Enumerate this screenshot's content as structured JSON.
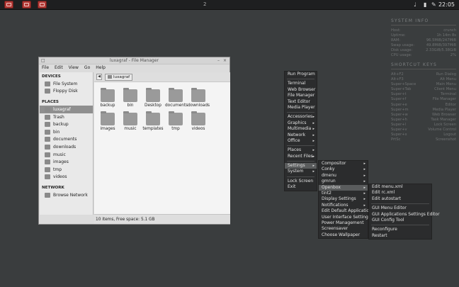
{
  "panel": {
    "workspace": "2",
    "clock": "22:05"
  },
  "conky_system": {
    "title": "SYSTEM INFO",
    "rows": [
      {
        "label": "Host:",
        "value": "crunch"
      },
      {
        "label": "Uptime:",
        "value": "1h 14m 8s"
      },
      {
        "label": "RAM:",
        "value": "96.5MiB/247MiB"
      },
      {
        "label": "Swap usage:",
        "value": "49.8MiB/397MiB"
      },
      {
        "label": "Disk usage:",
        "value": "2.33GiB/5.38GiB"
      },
      {
        "label": "CPU usage:",
        "value": "2%"
      }
    ]
  },
  "conky_keys": {
    "title": "SHORTCUT KEYS",
    "rows": [
      {
        "label": "Alt+F2",
        "value": "Run Dialog"
      },
      {
        "label": "Alt+F3",
        "value": "Alt Menu"
      },
      {
        "label": "Super+Space",
        "value": "Main Menu"
      },
      {
        "label": "Super+Tab",
        "value": "Client Menu"
      },
      {
        "label": "Super+t",
        "value": "Terminal"
      },
      {
        "label": "Super+f",
        "value": "File Manager"
      },
      {
        "label": "Super+e",
        "value": "Editor"
      },
      {
        "label": "Super+m",
        "value": "Media Player"
      },
      {
        "label": "Super+w",
        "value": "Web Browser"
      },
      {
        "label": "Super+h",
        "value": "Task Manager"
      },
      {
        "label": "Super+l",
        "value": "Lock Screen"
      },
      {
        "label": "Super+v",
        "value": "Volume Control"
      },
      {
        "label": "Super+x",
        "value": "Logout"
      },
      {
        "label": "PrtSc",
        "value": "Screenshot"
      }
    ]
  },
  "file_manager": {
    "title": "luxagraf - File Manager",
    "menu": [
      "File",
      "Edit",
      "View",
      "Go",
      "Help"
    ],
    "devices_heading": "DEVICES",
    "devices": [
      "File System",
      "Floppy Disk"
    ],
    "places_heading": "PLACES",
    "places": [
      "luxagraf",
      "Trash",
      "backup",
      "bin",
      "documents",
      "downloads",
      "music",
      "images",
      "tmp",
      "videos"
    ],
    "network_heading": "NETWORK",
    "network": [
      "Browse Network"
    ],
    "location": "luxagraf",
    "folders": [
      "backup",
      "bin",
      "Desktop",
      "documents",
      "downloads",
      "images",
      "music",
      "templates",
      "tmp",
      "videos"
    ],
    "status": "10 items, Free space: 5.1 GB"
  },
  "main_menu": {
    "items": [
      "Run Program",
      "Terminal",
      "Web Browser",
      "File Manager",
      "Text Editor",
      "Media Player",
      "Accessories",
      "Graphics",
      "Multimedia",
      "Network",
      "Office",
      "Places",
      "Recent Files",
      "Settings",
      "System",
      "Lock Screen",
      "Exit"
    ]
  },
  "settings_menu": {
    "items": [
      "Compositor",
      "Conky",
      "dmenu",
      "gmrun",
      "Openbox",
      "tint2",
      "Display Settings",
      "Notifications",
      "Edit Default Applications",
      "User Interface Settings",
      "Power Management",
      "Screensaver",
      "Choose Wallpaper"
    ]
  },
  "openbox_menu": {
    "items": [
      "Edit menu.xml",
      "Edit rc.xml",
      "Edit autostart",
      "GUI Menu Editor",
      "GUI Applications Settings Editor",
      "GUI Config Tool",
      "Reconfigure",
      "Restart"
    ]
  }
}
